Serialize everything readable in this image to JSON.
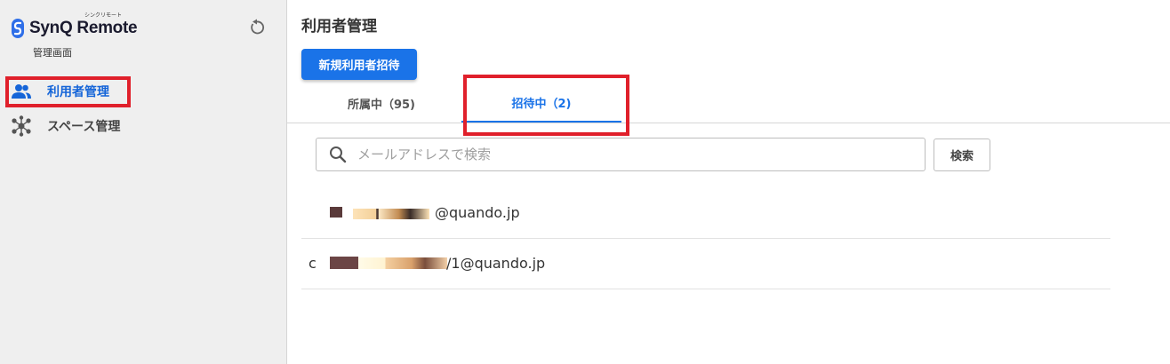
{
  "app": {
    "logo_text": "SynQ Remote",
    "logo_ruby": "シンクリモート",
    "admin_label": "管理画面"
  },
  "sidebar": {
    "items": [
      {
        "label": "利用者管理",
        "icon": "users-icon",
        "active": true
      },
      {
        "label": "スペース管理",
        "icon": "hub-icon",
        "active": false
      }
    ]
  },
  "main": {
    "title": "利用者管理",
    "invite_button": "新規利用者招待",
    "tabs": [
      {
        "label": "所属中（95)",
        "active": false
      },
      {
        "label": "招待中（2)",
        "active": true
      }
    ],
    "search": {
      "placeholder": "メールアドレスで検索",
      "value": "",
      "button": "検索"
    },
    "invited_rows": [
      {
        "email_visible": "@quando.jp"
      },
      {
        "prefix": "c",
        "email_visible": "/1@quando.jp"
      }
    ]
  },
  "colors": {
    "accent": "#1a73e8",
    "highlight": "#e0202b",
    "sidebar_bg": "#efefef"
  }
}
